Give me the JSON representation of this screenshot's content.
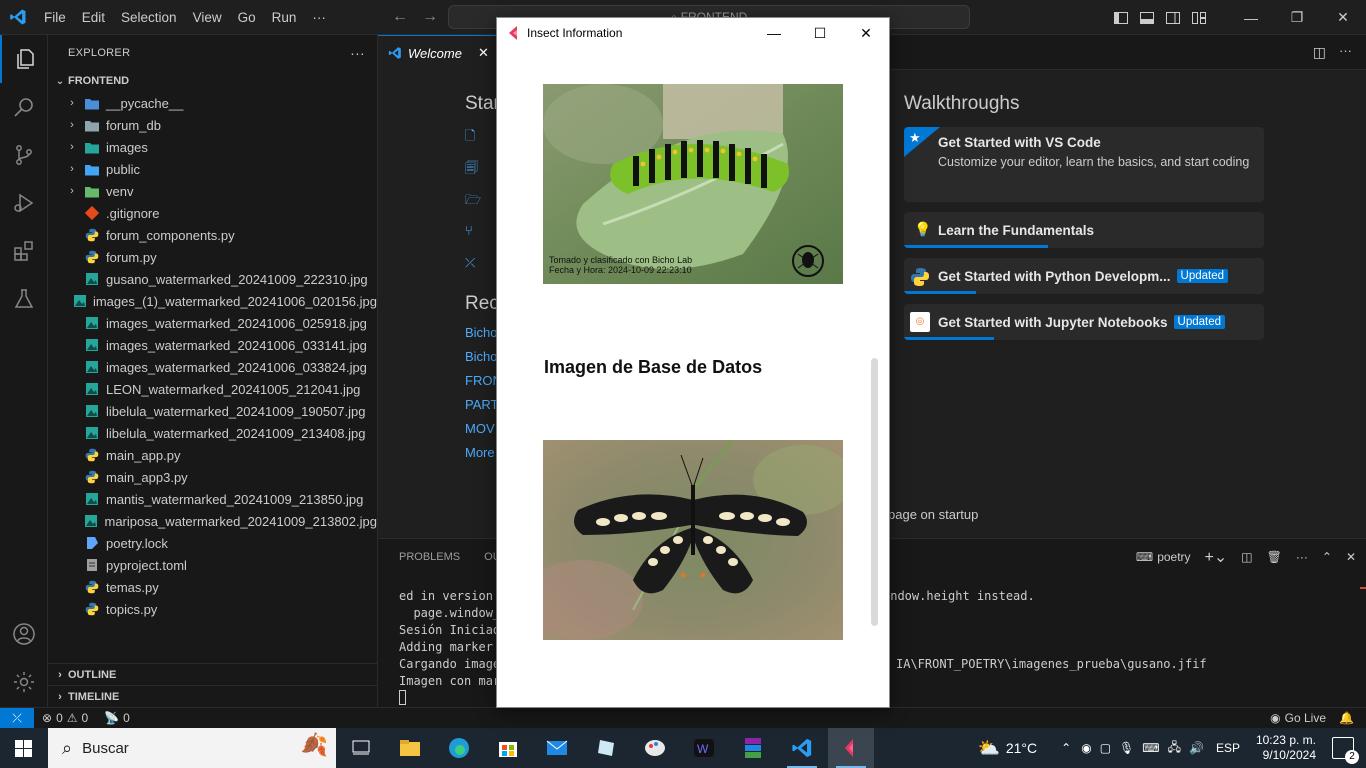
{
  "titlebar": {
    "menu": [
      "File",
      "Edit",
      "Selection",
      "View",
      "Go",
      "Run",
      "···"
    ],
    "command_center": "FRONTEND"
  },
  "sidebar": {
    "header": "EXPLORER",
    "root": "FRONTEND",
    "items": [
      {
        "label": "__pycache__",
        "type": "folder",
        "icon": "pycache-folder-icon",
        "color": "#4b8dd6"
      },
      {
        "label": "forum_db",
        "type": "folder",
        "icon": "folder-icon",
        "color": "#90a4ae"
      },
      {
        "label": "images",
        "type": "folder",
        "icon": "images-folder-icon",
        "color": "#26a69a"
      },
      {
        "label": "public",
        "type": "folder",
        "icon": "public-folder-icon",
        "color": "#42a5f5"
      },
      {
        "label": "venv",
        "type": "folder",
        "icon": "venv-folder-icon",
        "color": "#66bb6a"
      },
      {
        "label": ".gitignore",
        "type": "file",
        "icon": "git-icon",
        "color": "#e64a19"
      },
      {
        "label": "forum_components.py",
        "type": "file",
        "icon": "python-icon",
        "color": "#3776ab"
      },
      {
        "label": "forum.py",
        "type": "file",
        "icon": "python-icon",
        "color": "#3776ab"
      },
      {
        "label": "gusano_watermarked_20241009_222310.jpg",
        "type": "file",
        "icon": "image-icon",
        "color": "#26a69a"
      },
      {
        "label": "images_(1)_watermarked_20241006_020156.jpg",
        "type": "file",
        "icon": "image-icon",
        "color": "#26a69a"
      },
      {
        "label": "images_watermarked_20241006_025918.jpg",
        "type": "file",
        "icon": "image-icon",
        "color": "#26a69a"
      },
      {
        "label": "images_watermarked_20241006_033141.jpg",
        "type": "file",
        "icon": "image-icon",
        "color": "#26a69a"
      },
      {
        "label": "images_watermarked_20241006_033824.jpg",
        "type": "file",
        "icon": "image-icon",
        "color": "#26a69a"
      },
      {
        "label": "LEON_watermarked_20241005_212041.jpg",
        "type": "file",
        "icon": "image-icon",
        "color": "#26a69a"
      },
      {
        "label": "libelula_watermarked_20241009_190507.jpg",
        "type": "file",
        "icon": "image-icon",
        "color": "#26a69a"
      },
      {
        "label": "libelula_watermarked_20241009_213408.jpg",
        "type": "file",
        "icon": "image-icon",
        "color": "#26a69a"
      },
      {
        "label": "main_app.py",
        "type": "file",
        "icon": "python-icon",
        "color": "#3776ab"
      },
      {
        "label": "main_app3.py",
        "type": "file",
        "icon": "python-icon",
        "color": "#3776ab"
      },
      {
        "label": "mantis_watermarked_20241009_213850.jpg",
        "type": "file",
        "icon": "image-icon",
        "color": "#26a69a"
      },
      {
        "label": "mariposa_watermarked_20241009_213802.jpg",
        "type": "file",
        "icon": "image-icon",
        "color": "#26a69a"
      },
      {
        "label": "poetry.lock",
        "type": "file",
        "icon": "poetry-icon",
        "color": "#60a5fa"
      },
      {
        "label": "pyproject.toml",
        "type": "file",
        "icon": "toml-icon",
        "color": "#9e9e9e"
      },
      {
        "label": "temas.py",
        "type": "file",
        "icon": "python-icon",
        "color": "#3776ab"
      },
      {
        "label": "topics.py",
        "type": "file",
        "icon": "python-icon",
        "color": "#3776ab"
      }
    ],
    "outline": "OUTLINE",
    "timeline": "TIMELINE"
  },
  "editor": {
    "tab_label": "Welcome",
    "start_heading": "Star",
    "recent_heading": "Rec",
    "recent_links": [
      "Bicho",
      "Bicho",
      "FRON",
      "PART",
      "MOV",
      "More"
    ],
    "walkthroughs_heading": "Walkthroughs",
    "walkthroughs": [
      {
        "title": "Get Started with VS Code",
        "desc": "Customize your editor, learn the basics, and start coding",
        "badge": "",
        "progress": 0
      },
      {
        "title": "Learn the Fundamentals",
        "desc": "",
        "badge": "",
        "progress": 0.4
      },
      {
        "title": "Get Started with Python Developm...",
        "desc": "",
        "badge": "Updated",
        "progress": 0.2
      },
      {
        "title": "Get Started with Jupyter Notebooks",
        "desc": "",
        "badge": "Updated",
        "progress": 0.25
      }
    ],
    "startup_text": "page on startup"
  },
  "panel": {
    "tabs": [
      "PROBLEMS",
      "OUT"
    ],
    "terminal_name": "poetry",
    "lines_left": [
      "ed in version",
      "  page.window_",
      "Sesión Iniciad",
      "Adding marker",
      "Cargando image",
      "Imagen con mar"
    ],
    "line_right_1": "indow.height instead.",
    "line_right_2": "IA\\FRONT_POETRY\\imagenes_prueba\\gusano.jfif"
  },
  "statusbar": {
    "errors": "0",
    "warnings": "0",
    "ports": "0",
    "go_live": "Go Live"
  },
  "taskbar": {
    "search_placeholder": "Buscar",
    "weather": "21°C",
    "language": "ESP",
    "time": "10:23 p. m.",
    "date": "9/10/2024",
    "notifications": "2"
  },
  "popup": {
    "title": "Insect Information",
    "watermark_line1": "Tomado y clasificado con Bicho Lab",
    "watermark_line2": "Fecha y Hora: 2024-10-09 22:23:10",
    "heading": "Imagen de Base de Datos"
  },
  "colors": {
    "accent": "#0078d4",
    "link": "#4daafc"
  }
}
